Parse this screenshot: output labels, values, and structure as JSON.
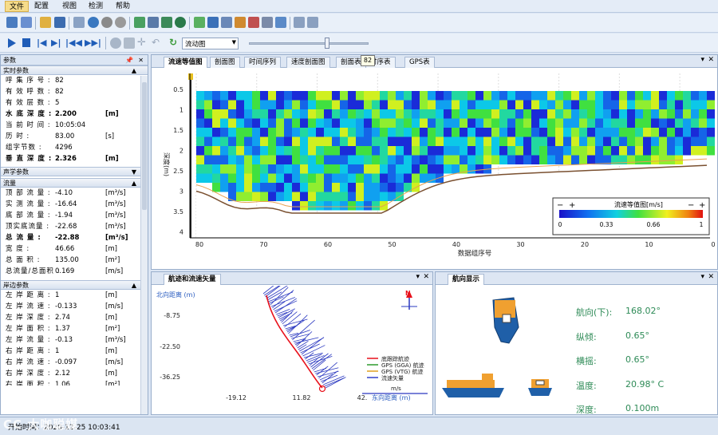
{
  "menu": [
    "文件",
    "配置",
    "视图",
    "检测",
    "帮助"
  ],
  "playback": {
    "mode_select": "流动图",
    "slider_tooltip": "82",
    "slider_pos": 0.63
  },
  "left": {
    "panel_title": "参数",
    "realtime": {
      "title": "实时参数",
      "rows": [
        {
          "k": "呼 集 序 号 :",
          "v": "82",
          "u": "",
          "b": false
        },
        {
          "k": "有 效 呼 数 :",
          "v": "82",
          "u": "",
          "b": false
        },
        {
          "k": "有 效 层 数 :",
          "v": "5",
          "u": "",
          "b": false
        },
        {
          "k": "水 底 深 度 :",
          "v": "2.200",
          "u": "[m]",
          "b": true
        },
        {
          "k": "当 前 时 间 :",
          "v": "10:05:04",
          "u": "",
          "b": false
        },
        {
          "k": "历       时 :",
          "v": "83.00",
          "u": "[s]",
          "b": false
        },
        {
          "k": "组字节数 :",
          "v": "4296",
          "u": "",
          "b": false
        },
        {
          "k": "垂 直 深 度 :",
          "v": "2.326",
          "u": "[m]",
          "b": true
        }
      ]
    },
    "acoustic": {
      "title": "声学参数"
    },
    "flow": {
      "title": "流量",
      "rows": [
        {
          "k": "顶 部 流 量 :",
          "v": "-4.10",
          "u": "[m³/s]",
          "b": false
        },
        {
          "k": "实 测 流 量 :",
          "v": "-16.64",
          "u": "[m³/s]",
          "b": false
        },
        {
          "k": "底 部 流 量 :",
          "v": "-1.94",
          "u": "[m³/s]",
          "b": false
        },
        {
          "k": "顶实底流量 :",
          "v": "-22.68",
          "u": "[m³/s]",
          "b": false
        },
        {
          "k": "总  流  量 :",
          "v": "-22.88",
          "u": "[m³/s]",
          "b": true
        },
        {
          "k": "宽       度 :",
          "v": "46.66",
          "u": "[m]",
          "b": false
        },
        {
          "k": "总  面  积 :",
          "v": "135.00",
          "u": "[m²]",
          "b": false
        },
        {
          "k": "总流量/总面积 :",
          "v": "0.169",
          "u": "[m/s]",
          "b": false
        }
      ]
    },
    "shore": {
      "title": "岸边参数",
      "rows": [
        {
          "k": "左 岸 距 离 :",
          "v": "1",
          "u": "[m]"
        },
        {
          "k": "左 岸 流 速 :",
          "v": "-0.133",
          "u": "[m/s]"
        },
        {
          "k": "左 岸 深 度 :",
          "v": "2.74",
          "u": "[m]"
        },
        {
          "k": "左 岸 面 积 :",
          "v": "1.37",
          "u": "[m²]"
        },
        {
          "k": "左 岸 流 量 :",
          "v": "-0.13",
          "u": "[m³/s]"
        },
        {
          "k": "右 岸 距 离 :",
          "v": "1",
          "u": "[m]"
        },
        {
          "k": "右 岸 流 速 :",
          "v": "-0.097",
          "u": "[m/s]"
        },
        {
          "k": "右 岸 深 度 :",
          "v": "2.12",
          "u": "[m]"
        },
        {
          "k": "右 岸 面 积 :",
          "v": "1.06",
          "u": "[m²]"
        }
      ]
    }
  },
  "tabs": [
    "流速等值图",
    "剖面图",
    "时间序列",
    "速度剖面图",
    "剖面表",
    "时序表",
    "GPS表"
  ],
  "contour": {
    "ylabel": "深度(m)",
    "xlabel": "数据组序号",
    "yticks": [
      "0.5",
      "1",
      "1.5",
      "2",
      "2.5",
      "3",
      "3.5",
      "4"
    ],
    "xticks": [
      "80",
      "70",
      "60",
      "50",
      "40",
      "30",
      "20",
      "10",
      "0"
    ],
    "colorbar_title": "流速等值图[m/s]",
    "colorbar_ticks": [
      "0",
      "0.33",
      "0.66",
      "1"
    ]
  },
  "track": {
    "title": "航迹和流速矢量",
    "ylabel": "北向距离 (m)",
    "xlabel": "东向距离 (m)",
    "yticks": [
      "-8.75",
      "-22.50",
      "-36.25"
    ],
    "xticks": [
      "-19.12",
      "11.82",
      "42."
    ],
    "north": "N",
    "unit": "m/s",
    "legend": [
      {
        "label": "底跟踪航迹",
        "color": "#e8101a"
      },
      {
        "label": "GPS (GGA) 航迹",
        "color": "#2e9b2e"
      },
      {
        "label": "GPS (VTG) 航迹",
        "color": "#e0a020"
      },
      {
        "label": "流速矢量",
        "color": "#3040c8"
      }
    ]
  },
  "nav": {
    "title": "航向显示",
    "items": [
      {
        "k": "航向(下):",
        "v": "168.02°"
      },
      {
        "k": "纵倾:",
        "v": "0.65°"
      },
      {
        "k": "横摇:",
        "v": "0.65°"
      },
      {
        "k": "温度:",
        "v": "20.98° C"
      },
      {
        "k": "深度:",
        "v": "0.100m"
      }
    ]
  },
  "status": {
    "text": "开始时间：2020-12-25 10:03:41",
    "watermark": "CC 大咖聪媒"
  }
}
